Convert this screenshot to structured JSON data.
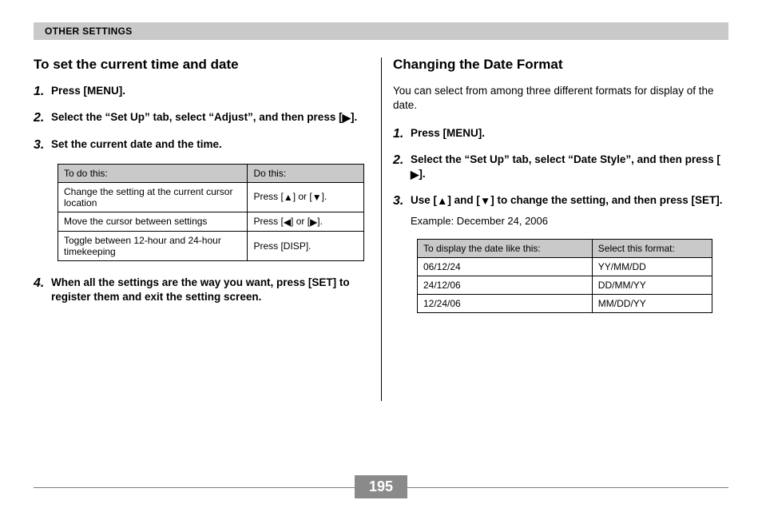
{
  "header": {
    "section_title": "OTHER SETTINGS"
  },
  "glyphs": {
    "right": "▶",
    "left": "◀",
    "up": "▲",
    "down": "▼"
  },
  "left_col": {
    "heading": "To set the current time and date",
    "steps": [
      {
        "num": "1.",
        "text": "Press [MENU]."
      },
      {
        "num": "2.",
        "text_prefix": "Select the “Set Up” tab, select “Adjust”, and then press [",
        "glyph": "right",
        "text_suffix": "]."
      },
      {
        "num": "3.",
        "text": "Set the current date and the time."
      },
      {
        "num": "4.",
        "text": "When all the settings are the way you want, press [SET] to register them and exit the setting screen."
      }
    ],
    "table": {
      "headers": [
        "To do this:",
        "Do this:"
      ],
      "rows": [
        {
          "col1": "Change the setting at the current cursor location",
          "col2_prefix": "Press [",
          "g1": "up",
          "col2_mid": "] or [",
          "g2": "down",
          "col2_suffix": "]."
        },
        {
          "col1": "Move the cursor between settings",
          "col2_prefix": "Press [",
          "g1": "left",
          "col2_mid": "] or [",
          "g2": "right",
          "col2_suffix": "]."
        },
        {
          "col1": "Toggle between 12-hour and 24-hour timekeeping",
          "col2_plain": "Press [DISP]."
        }
      ]
    }
  },
  "right_col": {
    "heading": "Changing the Date Format",
    "intro": "You can select from among three different formats for display of the date.",
    "steps": [
      {
        "num": "1.",
        "text": "Press [MENU]."
      },
      {
        "num": "2.",
        "text_prefix": "Select the “Set Up” tab, select “Date Style”, and then press [",
        "glyph": "right",
        "text_suffix": "]."
      },
      {
        "num": "3.",
        "text_prefix": "Use [",
        "g1": "up",
        "text_mid1": "] and [",
        "g2": "down",
        "text_suffix": "] to change the setting, and then press [SET].",
        "example": "Example: December 24, 2006"
      }
    ],
    "table": {
      "headers": [
        "To display the date like this:",
        "Select this format:"
      ],
      "rows": [
        {
          "c1": "06/12/24",
          "c2": "YY/MM/DD"
        },
        {
          "c1": "24/12/06",
          "c2": "DD/MM/YY"
        },
        {
          "c1": "12/24/06",
          "c2": "MM/DD/YY"
        }
      ]
    }
  },
  "footer": {
    "page_number": "195"
  }
}
